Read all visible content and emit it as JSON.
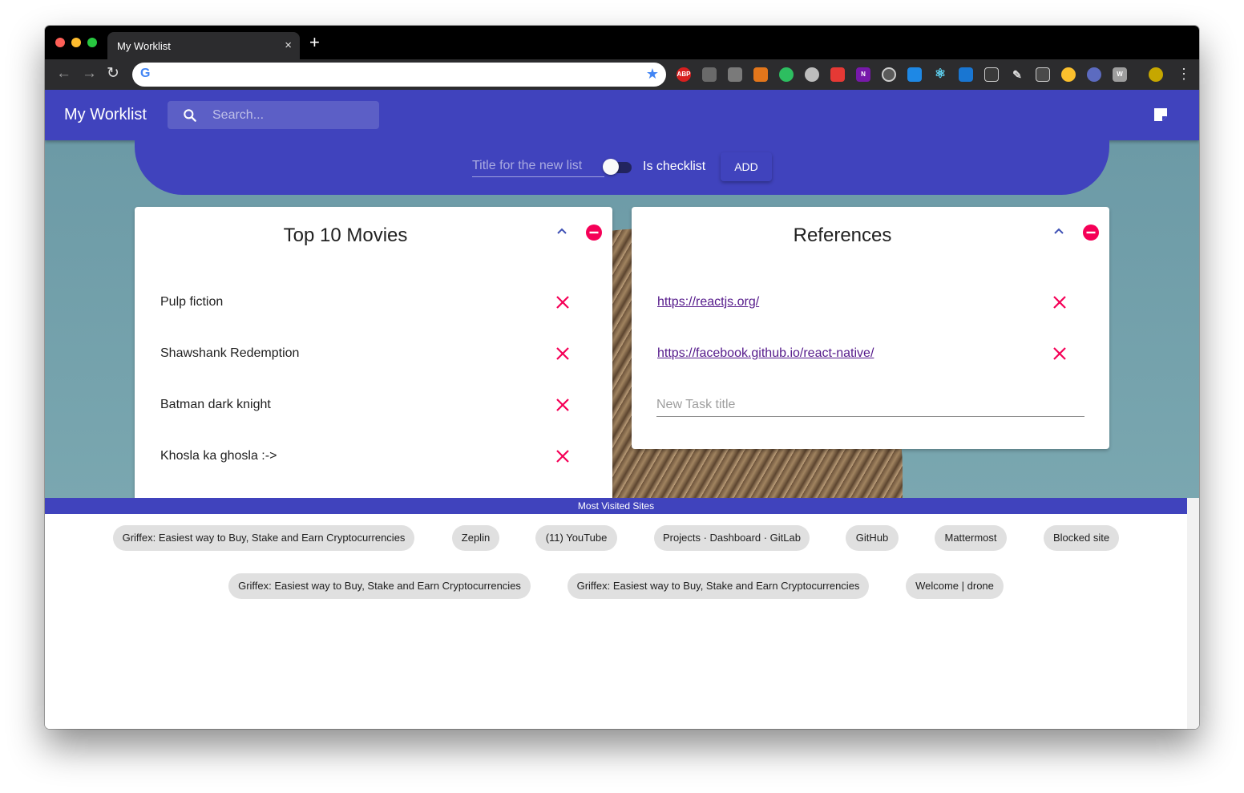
{
  "browser": {
    "tab_title": "My Worklist",
    "tab_close": "×",
    "new_tab": "+",
    "url": "",
    "extensions": [
      "ABP",
      "N",
      "W"
    ]
  },
  "appbar": {
    "title": "My Worklist",
    "search_placeholder": "Search..."
  },
  "new_list": {
    "placeholder": "Title for the new list",
    "checklist_label": "Is checklist",
    "add_label": "ADD"
  },
  "lists": [
    {
      "title": "Top 10 Movies",
      "items": [
        "Pulp fiction",
        "Shawshank Redemption",
        "Batman dark knight",
        "Khosla ka ghosla :->"
      ]
    },
    {
      "title": "References",
      "items": [
        "https://reactjs.org/",
        "https://facebook.github.io/react-native/"
      ],
      "new_task_placeholder": "New Task title"
    }
  ],
  "most_visited": {
    "header": "Most Visited Sites",
    "row1": [
      "Griffex: Easiest way to Buy, Stake and Earn Cryptocurrencies",
      "Zeplin",
      "(11) YouTube",
      "Projects · Dashboard · GitLab",
      "GitHub",
      "Mattermost",
      "Blocked site"
    ],
    "row2": [
      "Griffex: Easiest way to Buy, Stake and Earn Cryptocurrencies",
      "Griffex: Easiest way to Buy, Stake and Earn Cryptocurrencies",
      "Welcome | drone"
    ]
  },
  "colors": {
    "primary": "#4043bd",
    "accent": "#f50057",
    "link": "#551a8b"
  }
}
